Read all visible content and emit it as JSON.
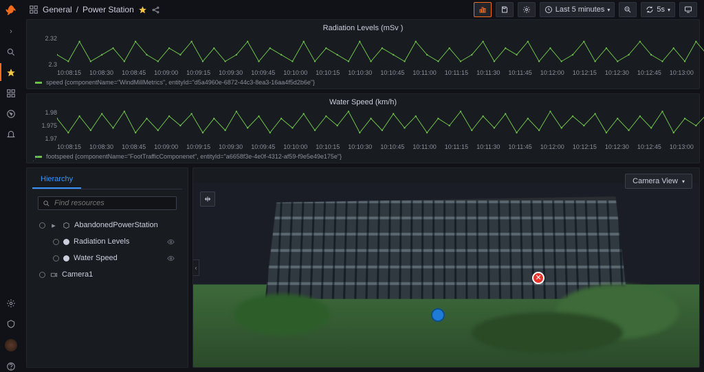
{
  "breadcrumb": {
    "folder": "General",
    "page": "Power Station"
  },
  "topbar": {
    "time_label": "Last 5 minutes",
    "refresh_interval": "5s"
  },
  "charts": {
    "radiation": {
      "title": "Radiation Levels (mSv )",
      "y_ticks": [
        "2.32",
        "2.3"
      ],
      "legend": "speed {componentName=\"WindMillMetrics\", entityId=\"d5a4960e-6872-44c3-8ea3-16aa4f5d2b6e\"}"
    },
    "water": {
      "title": "Water Speed (km/h)",
      "y_ticks": [
        "1.98",
        "1.975",
        "1.97"
      ],
      "legend": "footspeed {componentName=\"FootTrafficComponenet\", entityId=\"a6658f3e-4e0f-4312-af59-f9e5e49e175e\"}"
    },
    "x_ticks": [
      "10:08:15",
      "10:08:30",
      "10:08:45",
      "10:09:00",
      "10:09:15",
      "10:09:30",
      "10:09:45",
      "10:10:00",
      "10:10:15",
      "10:10:30",
      "10:10:45",
      "10:11:00",
      "10:11:15",
      "10:11:30",
      "10:11:45",
      "10:12:00",
      "10:12:15",
      "10:12:30",
      "10:12:45",
      "10:13:00"
    ]
  },
  "chart_data": [
    {
      "type": "line",
      "title": "Radiation Levels (mSv )",
      "xlabel": "",
      "ylabel": "",
      "ylim": [
        2.28,
        2.33
      ],
      "x": [
        "10:08:15",
        "10:08:30",
        "10:08:45",
        "10:09:00",
        "10:09:15",
        "10:09:30",
        "10:09:45",
        "10:10:00",
        "10:10:15",
        "10:10:30",
        "10:10:45",
        "10:11:00",
        "10:11:15",
        "10:11:30",
        "10:11:45",
        "10:12:00",
        "10:12:15",
        "10:12:30",
        "10:12:45",
        "10:13:00"
      ],
      "series": [
        {
          "name": "speed",
          "color": "#6dbf4b",
          "values": [
            2.3,
            2.29,
            2.32,
            2.29,
            2.3,
            2.31,
            2.29,
            2.32,
            2.3,
            2.29,
            2.31,
            2.3,
            2.32,
            2.29,
            2.31,
            2.29,
            2.3,
            2.32,
            2.29,
            2.31,
            2.3,
            2.29,
            2.32,
            2.29,
            2.31,
            2.3,
            2.29,
            2.32,
            2.29,
            2.31,
            2.3,
            2.29,
            2.32,
            2.3,
            2.29,
            2.31,
            2.29,
            2.3,
            2.32,
            2.29,
            2.31,
            2.3,
            2.32,
            2.29,
            2.31,
            2.29,
            2.3,
            2.32,
            2.29,
            2.31,
            2.29,
            2.3,
            2.32,
            2.3,
            2.29,
            2.31,
            2.29,
            2.32,
            2.3,
            2.31
          ]
        }
      ]
    },
    {
      "type": "line",
      "title": "Water Speed (km/h)",
      "xlabel": "",
      "ylabel": "",
      "ylim": [
        1.968,
        1.982
      ],
      "x": [
        "10:08:15",
        "10:08:30",
        "10:08:45",
        "10:09:00",
        "10:09:15",
        "10:09:30",
        "10:09:45",
        "10:10:00",
        "10:10:15",
        "10:10:30",
        "10:10:45",
        "10:11:00",
        "10:11:15",
        "10:11:30",
        "10:11:45",
        "10:12:00",
        "10:12:15",
        "10:12:30",
        "10:12:45",
        "10:13:00"
      ],
      "series": [
        {
          "name": "footspeed",
          "color": "#6dbf4b",
          "values": [
            1.978,
            1.972,
            1.979,
            1.973,
            1.98,
            1.974,
            1.981,
            1.972,
            1.978,
            1.973,
            1.979,
            1.975,
            1.98,
            1.972,
            1.978,
            1.973,
            1.981,
            1.974,
            1.979,
            1.972,
            1.978,
            1.974,
            1.98,
            1.973,
            1.979,
            1.975,
            1.981,
            1.972,
            1.978,
            1.973,
            1.98,
            1.974,
            1.979,
            1.972,
            1.978,
            1.975,
            1.981,
            1.973,
            1.979,
            1.974,
            1.98,
            1.972,
            1.978,
            1.973,
            1.981,
            1.974,
            1.979,
            1.975,
            1.98,
            1.972,
            1.978,
            1.973,
            1.979,
            1.974,
            1.981,
            1.972,
            1.978,
            1.975,
            1.98,
            1.973
          ]
        }
      ]
    }
  ],
  "hierarchy": {
    "tab_label": "Hierarchy",
    "search_placeholder": "Find resources",
    "items": [
      {
        "label": "AbandonedPowerStation",
        "icon": "scene",
        "depth": 0
      },
      {
        "label": "Radiation Levels",
        "icon": "node",
        "depth": 1,
        "selected": true
      },
      {
        "label": "Water Speed",
        "icon": "node",
        "depth": 1
      },
      {
        "label": "Camera1",
        "icon": "camera",
        "depth": 0
      }
    ]
  },
  "viewer": {
    "camera_button": "Camera View"
  },
  "colors": {
    "accent": "#f46b1c",
    "link": "#3794ff",
    "series": "#6dbf4b",
    "alert": "#e7352c",
    "info_marker": "#1e7bd6"
  }
}
